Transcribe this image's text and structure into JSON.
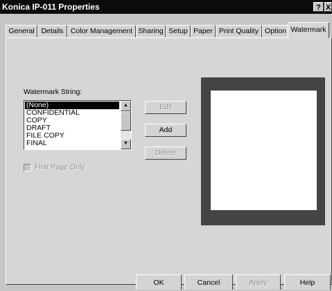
{
  "window": {
    "title": "Konica IP-011 Properties",
    "help_icon": "?",
    "close_icon": "X"
  },
  "tabs": [
    {
      "label": "General"
    },
    {
      "label": "Details"
    },
    {
      "label": "Color Management"
    },
    {
      "label": "Sharing"
    },
    {
      "label": "Setup"
    },
    {
      "label": "Paper"
    },
    {
      "label": "Print Quality"
    },
    {
      "label": "Option"
    },
    {
      "label": "Watermark",
      "active": true
    }
  ],
  "watermark": {
    "list_label": "Watermark String:",
    "items": [
      "(None)",
      "CONFIDENTIAL",
      "COPY",
      "DRAFT",
      "FILE COPY",
      "FINAL"
    ],
    "selected": "(None)",
    "edit_label": "Edit",
    "add_label": "Add",
    "delete_label": "Delete",
    "first_page_only_label": "First Page Only",
    "first_page_only_checked": false
  },
  "footer": {
    "ok_label": "OK",
    "cancel_label": "Cancel",
    "apply_label": "Apply",
    "help_label": "Help"
  },
  "icons": {
    "scroll_up": "scroll-up-arrow-icon",
    "scroll_down": "scroll-down-arrow-icon",
    "help": "help-icon",
    "close": "close-icon"
  },
  "colors": {
    "title_bar": "#0c0c0c",
    "dialog_face": "#c6c6c6",
    "preview_border": "#444444",
    "selected_item": "#000000"
  }
}
